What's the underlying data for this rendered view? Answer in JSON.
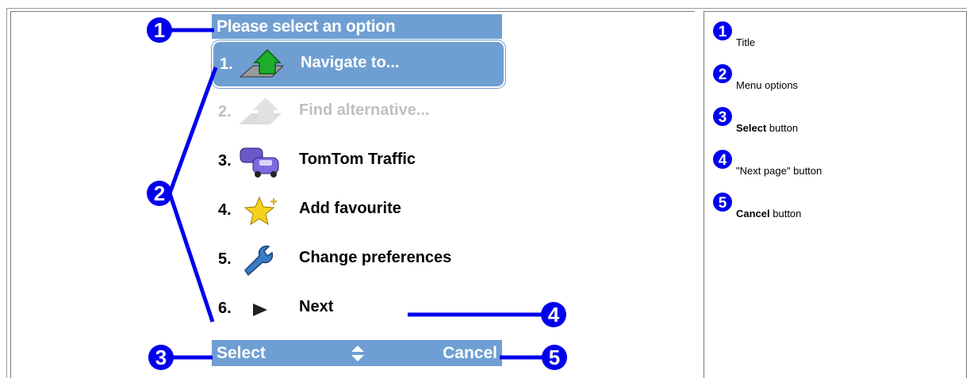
{
  "device": {
    "title": "Please select an option",
    "menu": [
      {
        "num": "1.",
        "label": "Navigate to...",
        "icon": "navigate-icon",
        "state": "selected"
      },
      {
        "num": "2.",
        "label": "Find alternative...",
        "icon": "find-alternative-icon",
        "state": "disabled"
      },
      {
        "num": "3.",
        "label": "TomTom Traffic",
        "icon": "traffic-cars-icon",
        "state": "normal"
      },
      {
        "num": "4.",
        "label": "Add favourite",
        "icon": "star-icon",
        "state": "normal"
      },
      {
        "num": "5.",
        "label": "Change preferences",
        "icon": "wrench-icon",
        "state": "normal"
      },
      {
        "num": "6.",
        "label": "Next",
        "icon": "next-arrow-icon",
        "state": "normal"
      }
    ],
    "bottom": {
      "select": "Select",
      "cancel": "Cancel",
      "arrows_icon": "up-down-arrows-icon"
    }
  },
  "callouts": [
    "1",
    "2",
    "3",
    "4",
    "5"
  ],
  "legend": [
    {
      "badge": "1",
      "bold": "",
      "text": "Title"
    },
    {
      "badge": "2",
      "bold": "",
      "text": "Menu options"
    },
    {
      "badge": "3",
      "bold": "Select",
      "text": " button"
    },
    {
      "badge": "4",
      "bold": "",
      "text": "\"Next page\" button"
    },
    {
      "badge": "5",
      "bold": "Cancel",
      "text": " button"
    }
  ],
  "colors": {
    "accent": "#6f9fd2",
    "callout": "#0000ee",
    "disabled": "#c0c0c0"
  }
}
